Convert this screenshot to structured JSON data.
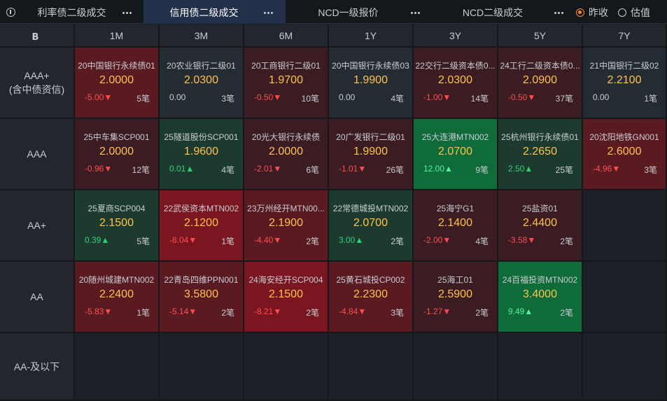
{
  "tabs": [
    {
      "label": "利率债二级成交",
      "active": false
    },
    {
      "label": "信用债二级成交",
      "active": true
    },
    {
      "label": "NCD一级报价",
      "active": false
    },
    {
      "label": "NCD二级成交",
      "active": false
    }
  ],
  "radios": [
    {
      "label": "昨收",
      "checked": true
    },
    {
      "label": "估值",
      "checked": false
    }
  ],
  "columns": [
    "1M",
    "3M",
    "6M",
    "1Y",
    "3Y",
    "5Y",
    "7Y"
  ],
  "rows": [
    {
      "label": "AAA+\n(含中债资信)",
      "cells": [
        {
          "name": "20中国银行永续债01",
          "price": "2.0000",
          "chg": "-5.00▼",
          "dir": "down",
          "cnt": "5笔",
          "tone": "red2"
        },
        {
          "name": "20农业银行二级01",
          "price": "2.0300",
          "chg": "0.00",
          "dir": "flat",
          "cnt": "3笔",
          "tone": "neutral"
        },
        {
          "name": "20工商银行二级01",
          "price": "1.9700",
          "chg": "-0.50▼",
          "dir": "down",
          "cnt": "10笔",
          "tone": "red1"
        },
        {
          "name": "20中国银行永续债03",
          "price": "1.9900",
          "chg": "0.00",
          "dir": "flat",
          "cnt": "4笔",
          "tone": "neutral"
        },
        {
          "name": "22交行二级资本债0...",
          "price": "2.0300",
          "chg": "-1.00▼",
          "dir": "down",
          "cnt": "14笔",
          "tone": "red1"
        },
        {
          "name": "24工行二级资本债0...",
          "price": "2.0900",
          "chg": "-0.50▼",
          "dir": "down",
          "cnt": "37笔",
          "tone": "red1"
        },
        {
          "name": "21中国银行二级02",
          "price": "2.2100",
          "chg": "0.00",
          "dir": "flat",
          "cnt": "1笔",
          "tone": "neutral"
        }
      ]
    },
    {
      "label": "AAA",
      "cells": [
        {
          "name": "25中车集SCP001",
          "price": "2.0000",
          "chg": "-0.96▼",
          "dir": "down",
          "cnt": "12笔",
          "tone": "red1"
        },
        {
          "name": "25隧道股份SCP001",
          "price": "1.9600",
          "chg": "0.01▲",
          "dir": "up",
          "cnt": "4笔",
          "tone": "green1"
        },
        {
          "name": "20光大银行永续债",
          "price": "2.0000",
          "chg": "-2.01▼",
          "dir": "down",
          "cnt": "6笔",
          "tone": "red1"
        },
        {
          "name": "20广发银行二级01",
          "price": "1.9900",
          "chg": "-1.01▼",
          "dir": "down",
          "cnt": "26笔",
          "tone": "red1"
        },
        {
          "name": "25大连港MTN002",
          "price": "2.0700",
          "chg": "12.00▲",
          "dir": "up",
          "cnt": "9笔",
          "tone": "green2"
        },
        {
          "name": "25杭州银行永续债01",
          "price": "2.2650",
          "chg": "2.50▲",
          "dir": "up",
          "cnt": "25笔",
          "tone": "green1"
        },
        {
          "name": "20沈阳地铁GN001",
          "price": "2.6000",
          "chg": "-4.96▼",
          "dir": "down",
          "cnt": "3笔",
          "tone": "red2"
        }
      ]
    },
    {
      "label": "AA+",
      "cells": [
        {
          "name": "25夏商SCP004",
          "price": "2.1500",
          "chg": "0.39▲",
          "dir": "up",
          "cnt": "5笔",
          "tone": "green1"
        },
        {
          "name": "22武侯资本MTN002",
          "price": "2.1200",
          "chg": "-8.04▼",
          "dir": "down",
          "cnt": "1笔",
          "tone": "red3"
        },
        {
          "name": "23万州经开MTN00...",
          "price": "2.1900",
          "chg": "-4.40▼",
          "dir": "down",
          "cnt": "2笔",
          "tone": "red2"
        },
        {
          "name": "22常德城投MTN002",
          "price": "2.0700",
          "chg": "3.00▲",
          "dir": "up",
          "cnt": "2笔",
          "tone": "green1"
        },
        {
          "name": "25海宁G1",
          "price": "2.1400",
          "chg": "-2.00▼",
          "dir": "down",
          "cnt": "4笔",
          "tone": "red1"
        },
        {
          "name": "25盐资01",
          "price": "2.4400",
          "chg": "-3.58▼",
          "dir": "down",
          "cnt": "2笔",
          "tone": "red1"
        },
        null
      ]
    },
    {
      "label": "AA",
      "cells": [
        {
          "name": "20随州城建MTN002",
          "price": "2.2400",
          "chg": "-5.83▼",
          "dir": "down",
          "cnt": "1笔",
          "tone": "red2"
        },
        {
          "name": "22青岛四维PPN001",
          "price": "3.5800",
          "chg": "-5.14▼",
          "dir": "down",
          "cnt": "2笔",
          "tone": "red2"
        },
        {
          "name": "24海安经开SCP004",
          "price": "2.1500",
          "chg": "-8.21▼",
          "dir": "down",
          "cnt": "2笔",
          "tone": "red3"
        },
        {
          "name": "25黄石城投CP002",
          "price": "2.2300",
          "chg": "-4.84▼",
          "dir": "down",
          "cnt": "3笔",
          "tone": "red2"
        },
        {
          "name": "25海工01",
          "price": "2.5900",
          "chg": "-1.27▼",
          "dir": "down",
          "cnt": "2笔",
          "tone": "red1"
        },
        {
          "name": "24百福投资MTN002",
          "price": "3.4000",
          "chg": "9.49▲",
          "dir": "up",
          "cnt": "2笔",
          "tone": "green2"
        },
        null
      ]
    },
    {
      "label": "AA-及以下",
      "cells": [
        null,
        null,
        null,
        null,
        null,
        null,
        null
      ]
    }
  ],
  "colors": {
    "accent": "#ff8a1e",
    "price": "#ffc24a",
    "down": "#ff4d4f",
    "up": "#2fd27a"
  },
  "icons": {
    "info": "info-icon",
    "logo": "logo-icon",
    "more": "more-dots-icon"
  }
}
